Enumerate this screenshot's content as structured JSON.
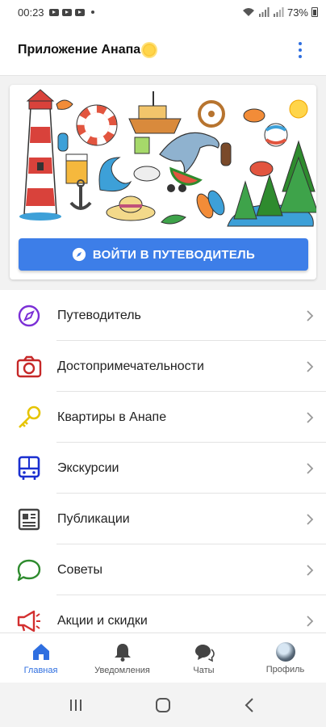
{
  "status_bar": {
    "time": "00:23",
    "battery": "73%"
  },
  "app_bar": {
    "title": "Приложение Анапа"
  },
  "banner": {
    "button_label": "ВОЙТИ В ПУТЕВОДИТЕЛЬ"
  },
  "menu": {
    "items": [
      {
        "label": "Путеводитель",
        "icon": "compass-icon",
        "color": "#7b2fd6"
      },
      {
        "label": "Достопримечательности",
        "icon": "camera-icon",
        "color": "#c62828"
      },
      {
        "label": "Квартиры в Анапе",
        "icon": "key-icon",
        "color": "#e6c400"
      },
      {
        "label": "Экскурсии",
        "icon": "bus-icon",
        "color": "#1a2fd0"
      },
      {
        "label": "Публикации",
        "icon": "newspaper-icon",
        "color": "#444444"
      },
      {
        "label": "Советы",
        "icon": "chat-bubble-icon",
        "color": "#2e8b2e"
      },
      {
        "label": "Акции и скидки",
        "icon": "megaphone-icon",
        "color": "#d32f2f"
      }
    ]
  },
  "bottom_nav": {
    "items": [
      {
        "label": "Главная",
        "icon": "home-icon",
        "active": true
      },
      {
        "label": "Уведомления",
        "icon": "bell-icon",
        "active": false
      },
      {
        "label": "Чаты",
        "icon": "chats-icon",
        "active": false
      },
      {
        "label": "Профиль",
        "icon": "avatar",
        "active": false
      }
    ]
  },
  "colors": {
    "accent": "#2f6fe0",
    "button": "#3d7ee8"
  }
}
